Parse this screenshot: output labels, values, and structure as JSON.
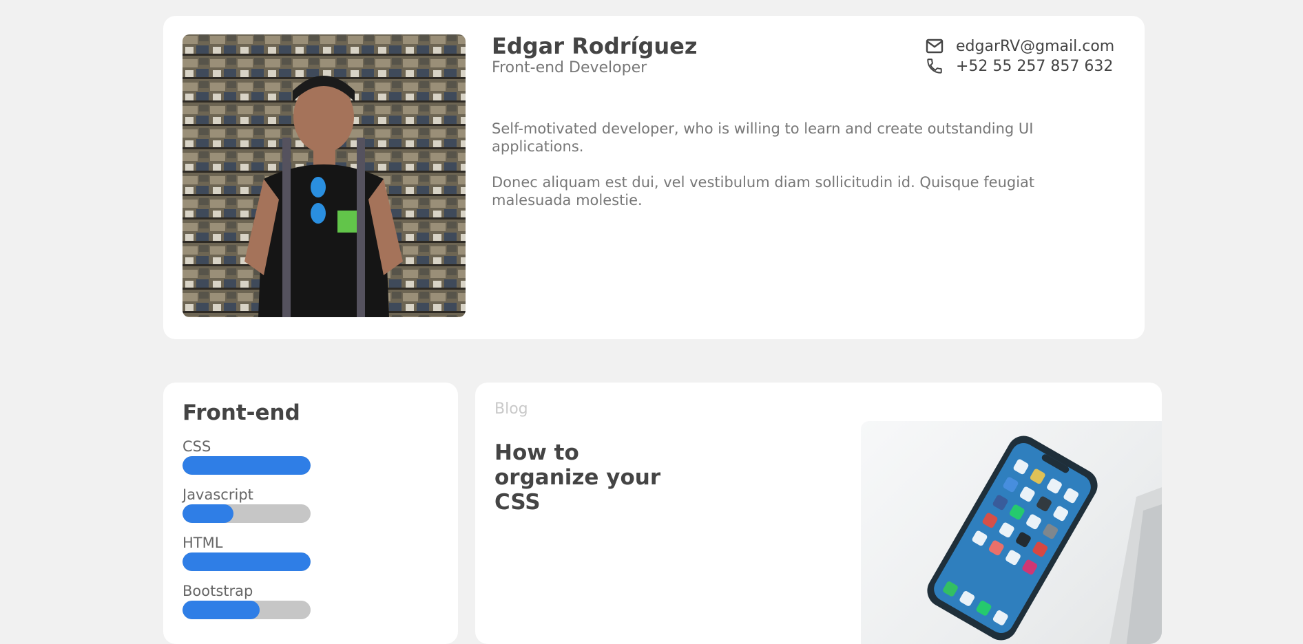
{
  "profile": {
    "name": "Edgar Rodríguez",
    "role": "Front-end Developer",
    "email": "edgarRV@gmail.com",
    "phone": "+52 55 257 857 632",
    "bio": [
      "Self-motivated developer, who is willing to learn and create outstanding UI applications.",
      "Donec aliquam est dui, vel vestibulum diam sollicitudin id. Quisque feugiat malesuada molestie."
    ]
  },
  "skills": {
    "title": "Front-end",
    "items": [
      {
        "label": "CSS",
        "level": 1.0
      },
      {
        "label": "Javascript",
        "level": 0.4
      },
      {
        "label": "HTML",
        "level": 1.0
      },
      {
        "label": "Bootstrap",
        "level": 0.6
      }
    ]
  },
  "blog": {
    "label": "Blog",
    "title": "How to organize your CSS"
  },
  "colors": {
    "accent": "#2f7ee6",
    "track": "#c6c6c6",
    "background": "#f1f1f1"
  }
}
